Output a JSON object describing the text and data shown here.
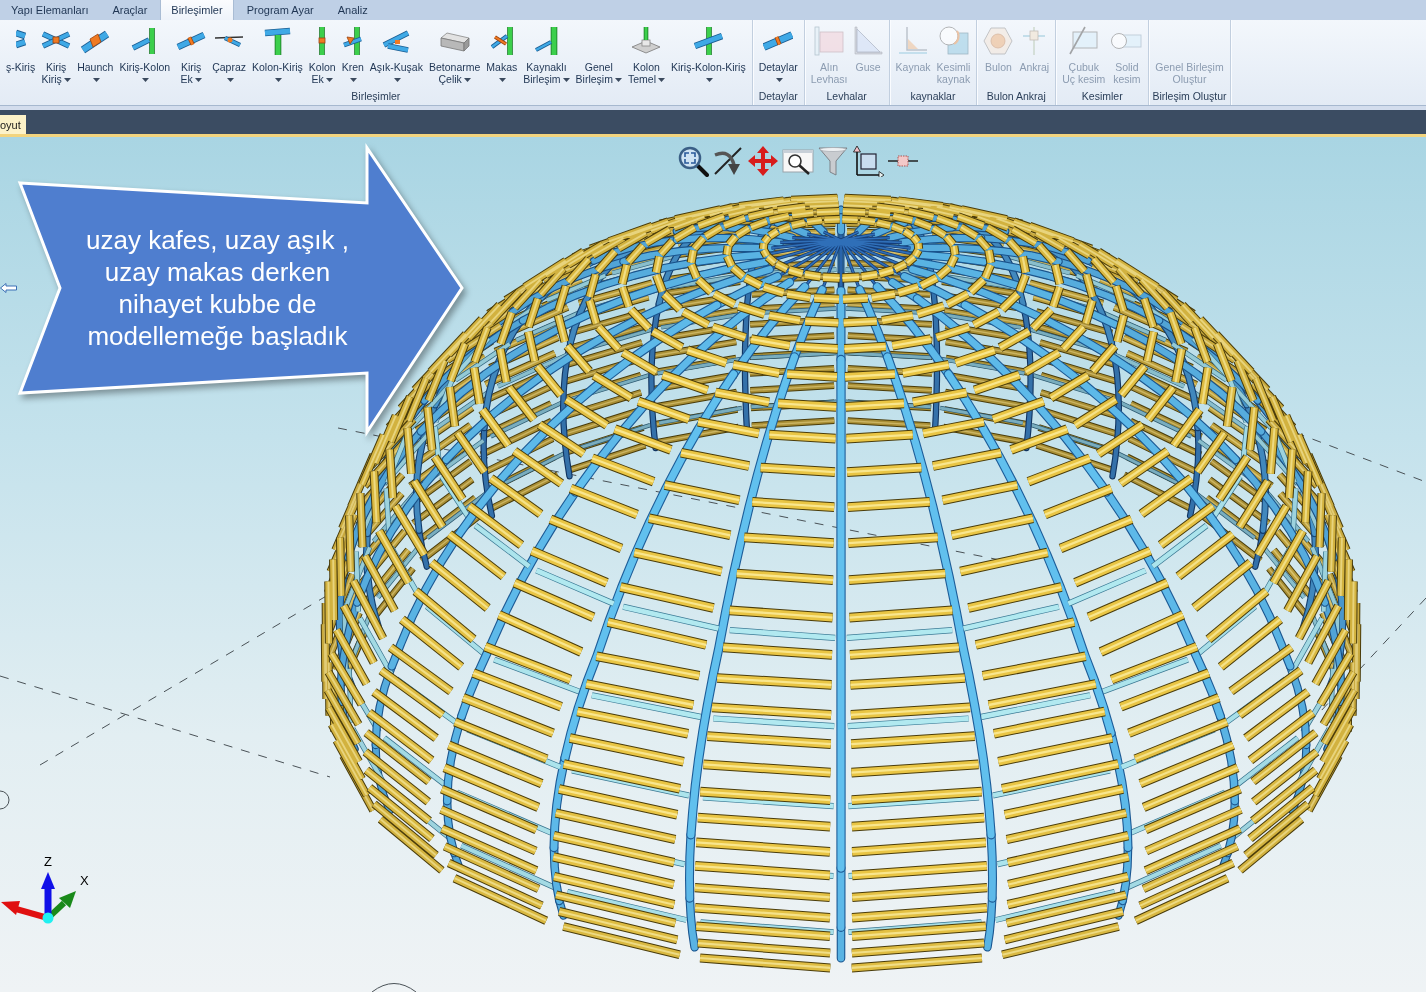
{
  "tabs": [
    {
      "label": "Yapı Elemanları",
      "selected": false
    },
    {
      "label": "Araçlar",
      "selected": false
    },
    {
      "label": "Birleşimler",
      "selected": true
    },
    {
      "label": "Program Ayar",
      "selected": false
    },
    {
      "label": "Analiz",
      "selected": false
    }
  ],
  "ribbon": {
    "groups": [
      {
        "label": "Birleşimler",
        "buttons": [
          {
            "lines": [
              "ş-Kiriş"
            ],
            "dropdown": false,
            "disabled": false
          },
          {
            "lines": [
              "Kiriş",
              "Kiriş"
            ],
            "dropdown": true,
            "disabled": false
          },
          {
            "lines": [
              "Haunch"
            ],
            "dropdown": true,
            "disabled": false
          },
          {
            "lines": [
              "Kiriş-Kolon"
            ],
            "dropdown": true,
            "disabled": false
          },
          {
            "lines": [
              "Kiriş",
              "Ek"
            ],
            "dropdown": true,
            "disabled": false
          },
          {
            "lines": [
              "Çapraz"
            ],
            "dropdown": true,
            "disabled": false
          },
          {
            "lines": [
              "Kolon-Kiriş"
            ],
            "dropdown": true,
            "disabled": false
          },
          {
            "lines": [
              "Kolon",
              "Ek"
            ],
            "dropdown": true,
            "disabled": false
          },
          {
            "lines": [
              "Kren"
            ],
            "dropdown": true,
            "disabled": false
          },
          {
            "lines": [
              "Aşık-Kuşak"
            ],
            "dropdown": true,
            "disabled": false
          },
          {
            "lines": [
              "Betonarme",
              "Çelik"
            ],
            "dropdown": true,
            "disabled": false
          },
          {
            "lines": [
              "Makas"
            ],
            "dropdown": true,
            "disabled": false
          },
          {
            "lines": [
              "Kaynaklı",
              "Birleşim"
            ],
            "dropdown": true,
            "disabled": false
          },
          {
            "lines": [
              "Genel",
              "Birleşim"
            ],
            "dropdown": true,
            "disabled": false
          },
          {
            "lines": [
              "Kolon",
              "Temel"
            ],
            "dropdown": true,
            "disabled": false
          },
          {
            "lines": [
              "Kiriş-Kolon-Kiriş"
            ],
            "dropdown": true,
            "disabled": false
          }
        ]
      },
      {
        "label": "Detaylar",
        "buttons": [
          {
            "lines": [
              "Detaylar"
            ],
            "dropdown": true,
            "disabled": false
          }
        ]
      },
      {
        "label": "Levhalar",
        "buttons": [
          {
            "lines": [
              "Alın",
              "Levhası"
            ],
            "dropdown": false,
            "disabled": true
          },
          {
            "lines": [
              "Guse"
            ],
            "dropdown": false,
            "disabled": true
          }
        ]
      },
      {
        "label": "kaynaklar",
        "buttons": [
          {
            "lines": [
              "Kaynak"
            ],
            "dropdown": false,
            "disabled": true
          },
          {
            "lines": [
              "Kesimli",
              "kaynak"
            ],
            "dropdown": false,
            "disabled": true
          }
        ]
      },
      {
        "label": "Bulon Ankraj",
        "buttons": [
          {
            "lines": [
              "Bulon"
            ],
            "dropdown": false,
            "disabled": true
          },
          {
            "lines": [
              "Ankraj"
            ],
            "dropdown": false,
            "disabled": true
          }
        ]
      },
      {
        "label": "Kesimler",
        "buttons": [
          {
            "lines": [
              "Çubuk",
              "Uç kesim"
            ],
            "dropdown": false,
            "disabled": true
          },
          {
            "lines": [
              "Solid",
              "kesim"
            ],
            "dropdown": false,
            "disabled": true
          }
        ]
      },
      {
        "label": "Birleşim Oluştur",
        "buttons": [
          {
            "lines": [
              "Genel Birleşim",
              "Oluştur"
            ],
            "dropdown": false,
            "disabled": true
          }
        ]
      }
    ]
  },
  "document_tab": {
    "label": "oyut"
  },
  "callout": {
    "lines": [
      "uzay kafes, uzay aşık ,",
      "uzay makas derken",
      "nihayet kubbe de",
      "modellemeğe başladık"
    ]
  },
  "axes": {
    "z_label": "Z",
    "x_label": "X"
  }
}
